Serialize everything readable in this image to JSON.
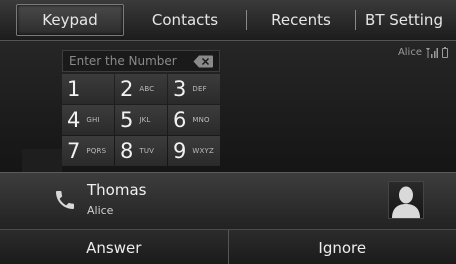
{
  "tabs": [
    {
      "label": "Keypad"
    },
    {
      "label": "Contacts"
    },
    {
      "label": "Recents"
    },
    {
      "label": "BT Setting"
    }
  ],
  "keypad": {
    "placeholder": "Enter the Number",
    "keys": [
      {
        "digit": "1",
        "letters": ""
      },
      {
        "digit": "2",
        "letters": "ABC"
      },
      {
        "digit": "3",
        "letters": "DEF"
      },
      {
        "digit": "4",
        "letters": "GHI"
      },
      {
        "digit": "5",
        "letters": "JKL"
      },
      {
        "digit": "6",
        "letters": "MNO"
      },
      {
        "digit": "7",
        "letters": "PQRS"
      },
      {
        "digit": "8",
        "letters": "TUV"
      },
      {
        "digit": "9",
        "letters": "WXYZ"
      }
    ]
  },
  "status": {
    "device_name": "Alice"
  },
  "incoming_call": {
    "name": "Thomas",
    "subtitle": "Alice"
  },
  "actions": {
    "answer_label": "Answer",
    "ignore_label": "Ignore"
  },
  "icons": {
    "phone": "phone-icon",
    "backspace": "backspace-icon",
    "signal": "signal-icon",
    "battery": "battery-icon",
    "avatar": "contact-avatar-icon"
  }
}
